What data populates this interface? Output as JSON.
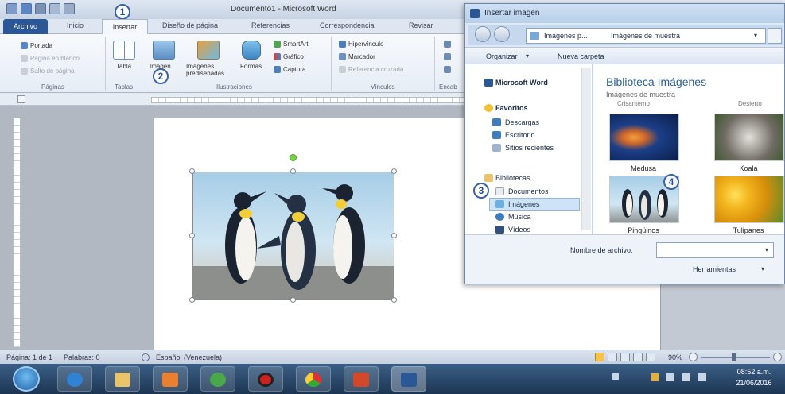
{
  "word": {
    "title": "Documento1 - Microsoft Word",
    "tabs": [
      "Archivo",
      "Inicio",
      "Insertar",
      "Diseño de página",
      "Referencias",
      "Correspondencia",
      "Revisar"
    ],
    "ribbon": {
      "paginas": [
        "Portada",
        "Página en blanco",
        "Salto de página"
      ],
      "tabla": "Tabla",
      "imagen": "Imagen",
      "imagenes_pred": "Imágenes prediseñadas",
      "formas": "Formas",
      "ilus_small": [
        "SmartArt",
        "Gráfico",
        "Captura"
      ],
      "vinculos": [
        "Hipervínculo",
        "Marcador",
        "Referencia cruzada"
      ],
      "groups": [
        "Páginas",
        "Tablas",
        "Ilustraciones",
        "Vínculos",
        "Encab"
      ]
    },
    "status": {
      "pagina": "Página: 1 de 1",
      "palabras": "Palabras: 0",
      "idioma": "Español (Venezuela)",
      "zoom": "90%"
    },
    "clock": {
      "time": "08:52 a.m.",
      "date": "21/06/2016"
    }
  },
  "steps": [
    "1",
    "2",
    "3",
    "4"
  ],
  "dialog": {
    "title": "Insertar imagen",
    "path": [
      "Imágenes p...",
      "Imágenes de muestra"
    ],
    "search_icon": "search-icon",
    "commands": [
      "Organizar",
      "Nueva carpeta"
    ],
    "nav": {
      "word": "Microsoft Word",
      "favoritos": "Favoritos",
      "fav_items": [
        "Descargas",
        "Escritorio",
        "Sitios recientes"
      ],
      "bibliotecas": "Bibliotecas",
      "lib_items": [
        "Documentos",
        "Imágenes",
        "Música",
        "Vídeos"
      ]
    },
    "library_title": "Biblioteca Imágenes",
    "library_sub": "Imágenes de muestra",
    "thumbs": [
      "Medusa",
      "Koala",
      "Pingüinos",
      "Tulipanes"
    ],
    "top_partial": [
      "Crisantemo",
      "Desierto"
    ],
    "filename_label": "Nombre de archivo:",
    "tools_label": "Herramientas"
  },
  "colors": {
    "word_blue": "#2b5797",
    "accent": "#3a63a8"
  }
}
